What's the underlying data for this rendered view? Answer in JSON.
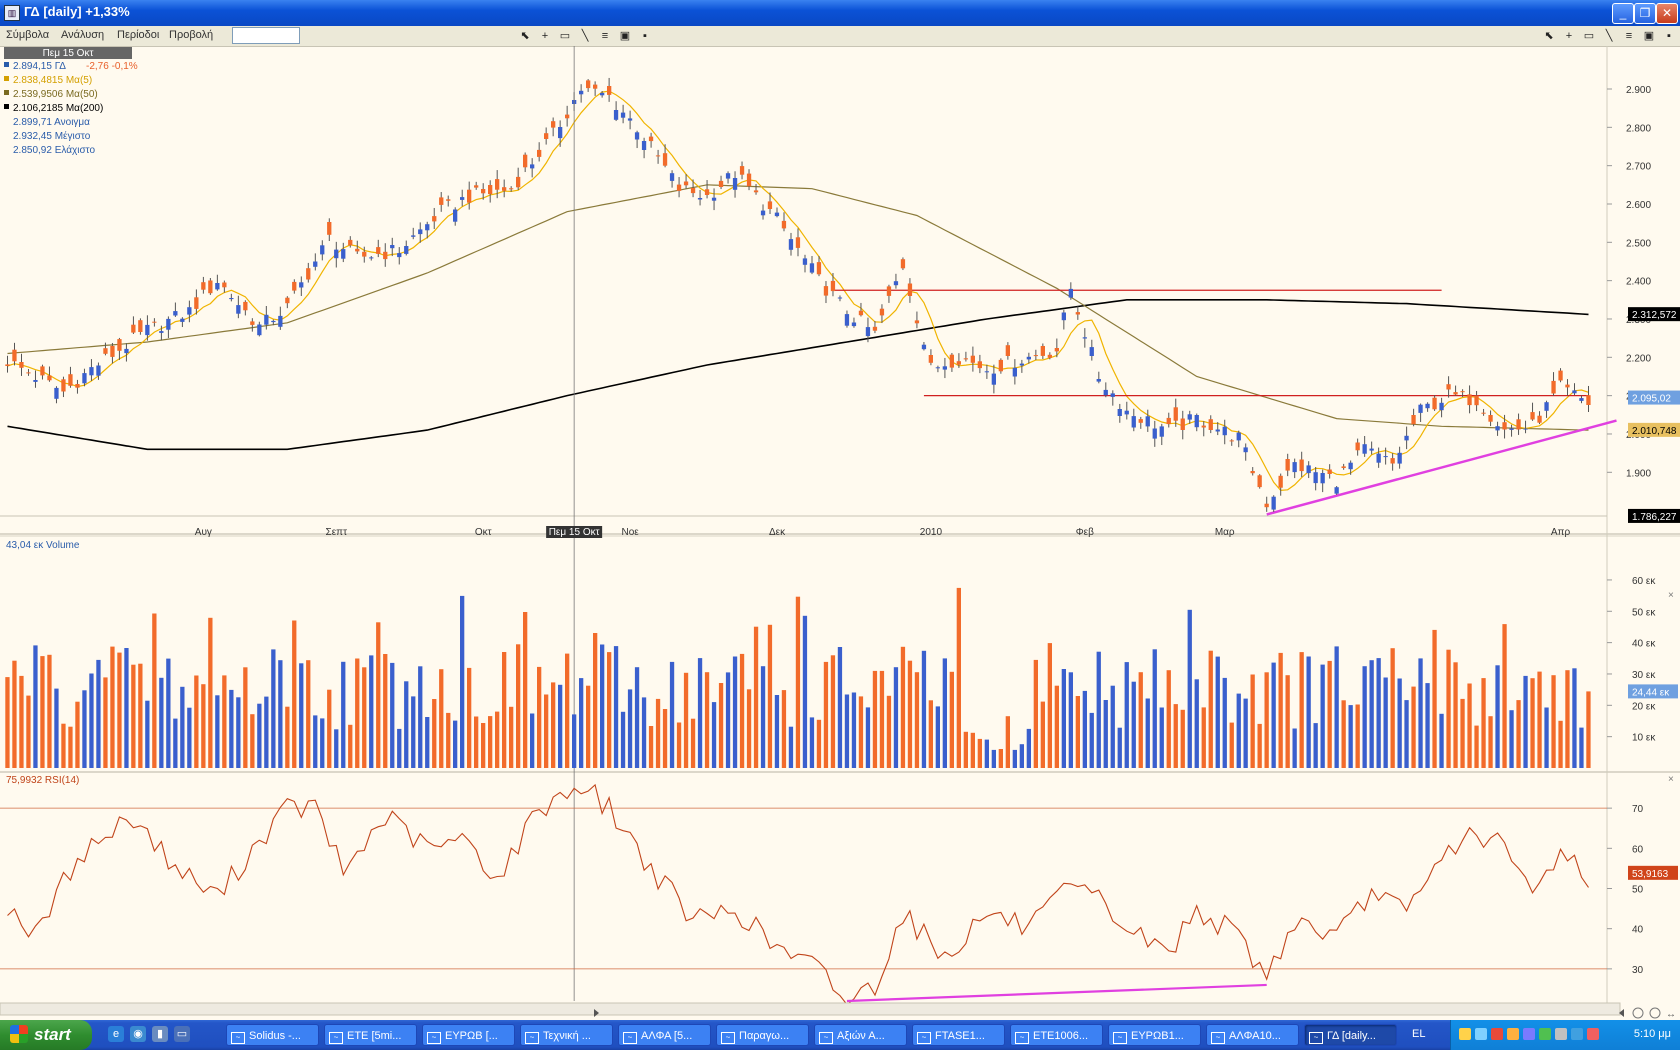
{
  "window": {
    "title": "ΓΔ [daily] +1,33%",
    "icon": "chart-window-icon",
    "buttons": [
      "minimize-icon",
      "restore-icon",
      "close-icon"
    ]
  },
  "menu": {
    "items": [
      "Σύμβολα",
      "Ανάλυση",
      "Περίοδοι",
      "Προβολή"
    ],
    "symbol_value": ""
  },
  "toolbar": {
    "icons": [
      "cursor-icon",
      "crosshair-icon",
      "rectangle-icon",
      "line-icon",
      "list-icon",
      "chart-icon",
      "save-icon"
    ]
  },
  "legend": {
    "date": "Πεμ 15 Οκτ",
    "rows": [
      {
        "text": "2.894,15 ΓΔ",
        "extra": "-2,76 -0,1%",
        "color": "#2a5caa",
        "extracolor": "#e8602c"
      },
      {
        "text": "2.838,4815 Μα(5)",
        "color": "#d4a000"
      },
      {
        "text": "2.539,9506 Μα(50)",
        "color": "#7a6a20"
      },
      {
        "text": "2.106,2185 Μα(200)",
        "color": "#000000"
      },
      {
        "text": "2.899,71 Ανοιγμα",
        "color": "#2a5caa"
      },
      {
        "text": "2.932,45 Μέγιστο",
        "color": "#2a5caa"
      },
      {
        "text": "2.850,92 Ελάχιστο",
        "color": "#2a5caa"
      }
    ]
  },
  "colors": {
    "up": "#3a5fcd",
    "down": "#f26b2a",
    "ma5": "#f0b400",
    "ma50": "#8a7a3a",
    "ma200": "#000000",
    "rsi": "#c0441a",
    "trend": "#e040e0",
    "level": "#d02020",
    "bg": "#fffaef"
  },
  "chart_data": [
    {
      "type": "candlestick",
      "title": "ΓΔ [daily]",
      "x_labels": [
        "Αυγ",
        "Σεπτ",
        "Οκτ",
        "Νοε",
        "Δεκ",
        "2010",
        "Φεβ",
        "Μαρ",
        "Απρ"
      ],
      "crosshair_date": "Πεμ 15 Οκτ",
      "y_ticks": [
        1900,
        2000,
        2100,
        2200,
        2300,
        2400,
        2500,
        2600,
        2700,
        2800,
        2900
      ],
      "y_tick_labels": [
        "1.900",
        "2.000",
        "2.100",
        "2.200",
        "2.300",
        "2.400",
        "2.500",
        "2.600",
        "2.700",
        "2.800",
        "2.900"
      ],
      "ylim": [
        1786,
        2960
      ],
      "last_labels": [
        {
          "text": "2.312,572",
          "value": 2312.6,
          "bg": "#000000",
          "fg": "#ffffff"
        },
        {
          "text": "2.095,02",
          "value": 2095,
          "bg": "#6fa0e0",
          "fg": "#ffffff"
        },
        {
          "text": "2.010,748",
          "value": 2010.7,
          "bg": "#e8c060",
          "fg": "#000000"
        },
        {
          "text": "1.786,227",
          "value": 1786.2,
          "bg": "#000000",
          "fg": "#ffffff"
        }
      ],
      "close_keypoints": [
        [
          0,
          2190
        ],
        [
          8,
          2110
        ],
        [
          12,
          2170
        ],
        [
          20,
          2270
        ],
        [
          26,
          2320
        ],
        [
          30,
          2400
        ],
        [
          36,
          2280
        ],
        [
          40,
          2330
        ],
        [
          46,
          2510
        ],
        [
          50,
          2460
        ],
        [
          56,
          2480
        ],
        [
          62,
          2580
        ],
        [
          66,
          2620
        ],
        [
          72,
          2640
        ],
        [
          78,
          2780
        ],
        [
          82,
          2900
        ],
        [
          86,
          2880
        ],
        [
          90,
          2800
        ],
        [
          96,
          2640
        ],
        [
          100,
          2620
        ],
        [
          104,
          2680
        ],
        [
          110,
          2560
        ],
        [
          116,
          2400
        ],
        [
          120,
          2320
        ],
        [
          124,
          2260
        ],
        [
          128,
          2440
        ],
        [
          132,
          2170
        ],
        [
          136,
          2200
        ],
        [
          140,
          2170
        ],
        [
          146,
          2200
        ],
        [
          150,
          2220
        ],
        [
          152,
          2380
        ],
        [
          156,
          2150
        ],
        [
          160,
          2060
        ],
        [
          166,
          2010
        ],
        [
          170,
          2040
        ],
        [
          176,
          1990
        ],
        [
          180,
          1820
        ],
        [
          184,
          1920
        ],
        [
          190,
          1880
        ],
        [
          194,
          1960
        ],
        [
          198,
          1920
        ],
        [
          202,
          2060
        ],
        [
          206,
          2100
        ],
        [
          210,
          2090
        ],
        [
          214,
          2010
        ],
        [
          218,
          2020
        ],
        [
          222,
          2120
        ],
        [
          226,
          2080
        ]
      ],
      "ma200_keypoints": [
        [
          0,
          2020
        ],
        [
          20,
          1960
        ],
        [
          40,
          1960
        ],
        [
          60,
          2010
        ],
        [
          80,
          2100
        ],
        [
          100,
          2180
        ],
        [
          120,
          2240
        ],
        [
          140,
          2300
        ],
        [
          160,
          2350
        ],
        [
          180,
          2350
        ],
        [
          200,
          2340
        ],
        [
          226,
          2312
        ]
      ],
      "ma50_keypoints": [
        [
          0,
          2210
        ],
        [
          20,
          2240
        ],
        [
          40,
          2290
        ],
        [
          60,
          2420
        ],
        [
          80,
          2580
        ],
        [
          100,
          2650
        ],
        [
          115,
          2640
        ],
        [
          130,
          2570
        ],
        [
          150,
          2380
        ],
        [
          170,
          2150
        ],
        [
          190,
          2040
        ],
        [
          205,
          2020
        ],
        [
          226,
          2010
        ]
      ],
      "hlines": [
        {
          "value": 2375,
          "from": 118,
          "to": 205
        },
        {
          "value": 2100,
          "from": 131,
          "to": 226
        }
      ],
      "trendline": {
        "x1": 180,
        "y1": 1790,
        "x2": 230,
        "y2": 2035
      }
    },
    {
      "type": "bar",
      "title": "Volume",
      "legend": "43,04 εκ Volume",
      "y_ticks": [
        10,
        20,
        30,
        40,
        50,
        60
      ],
      "y_tick_labels": [
        "10 εκ",
        "20 εκ",
        "30 εκ",
        "40 εκ",
        "50 εκ",
        "60 εκ"
      ],
      "ylim": [
        0,
        67
      ],
      "last_label": {
        "text": "24,44 εκ",
        "value": 24.44
      }
    },
    {
      "type": "line",
      "title": "RSI(14)",
      "legend": "75,9932 RSI(14)",
      "y_ticks": [
        30,
        40,
        50,
        60,
        70
      ],
      "ylim": [
        22,
        78
      ],
      "reference_lines": [
        30,
        70
      ],
      "last_label": {
        "text": "53,9163",
        "value": 53.9
      },
      "rsi_keypoints": [
        [
          0,
          46
        ],
        [
          4,
          38
        ],
        [
          10,
          58
        ],
        [
          18,
          68
        ],
        [
          24,
          55
        ],
        [
          30,
          48
        ],
        [
          36,
          62
        ],
        [
          40,
          70
        ],
        [
          44,
          70
        ],
        [
          48,
          54
        ],
        [
          54,
          68
        ],
        [
          60,
          60
        ],
        [
          66,
          62
        ],
        [
          70,
          52
        ],
        [
          76,
          70
        ],
        [
          82,
          76
        ],
        [
          86,
          70
        ],
        [
          92,
          55
        ],
        [
          98,
          42
        ],
        [
          104,
          45
        ],
        [
          110,
          35
        ],
        [
          116,
          30
        ],
        [
          120,
          22
        ],
        [
          124,
          26
        ],
        [
          128,
          44
        ],
        [
          134,
          33
        ],
        [
          140,
          44
        ],
        [
          146,
          40
        ],
        [
          152,
          50
        ],
        [
          156,
          47
        ],
        [
          160,
          40
        ],
        [
          166,
          34
        ],
        [
          170,
          45
        ],
        [
          176,
          38
        ],
        [
          180,
          28
        ],
        [
          184,
          42
        ],
        [
          190,
          38
        ],
        [
          196,
          50
        ],
        [
          200,
          43
        ],
        [
          206,
          60
        ],
        [
          210,
          64
        ],
        [
          214,
          60
        ],
        [
          218,
          48
        ],
        [
          222,
          60
        ],
        [
          226,
          53
        ]
      ],
      "divergence_line": {
        "x1": 120,
        "y1": 22,
        "x2": 180,
        "y2": 26
      }
    }
  ],
  "taskbar": {
    "start_label": "start",
    "tasks": [
      "Solidus -...",
      "ETE [5mi...",
      "ΕΥΡΩΒ [...",
      "Τεχνική ...",
      "ΑΛΦΑ [5...",
      "Παραγω...",
      "Αξιών Α...",
      "FTASE1...",
      "ETE1006...",
      "ΕΥΡΩΒ1...",
      "ΑΛΦΑ10...",
      "ΓΔ [daily..."
    ],
    "active_index": 11,
    "lang": "EL",
    "clock": "5:10 μμ"
  }
}
